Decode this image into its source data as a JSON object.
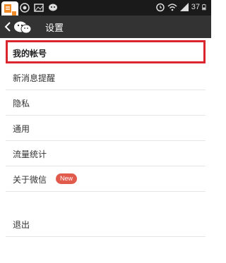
{
  "status_bar": {
    "battery_level": "37",
    "icons": [
      "notification-icon",
      "message-icon",
      "image-icon",
      "chat-icon",
      "alarm-icon",
      "wifi-icon",
      "signal-icon",
      "battery-icon"
    ]
  },
  "title_bar": {
    "title": "设置"
  },
  "menu": {
    "items": [
      {
        "label": "我的帐号"
      },
      {
        "label": "新消息提醒"
      },
      {
        "label": "隐私"
      },
      {
        "label": "通用"
      },
      {
        "label": "流量统计"
      },
      {
        "label": "关于微信",
        "badge": "New"
      },
      {
        "label": "退出"
      }
    ]
  },
  "colors": {
    "highlight": "#d9262e",
    "badge": "#e15b4d",
    "title_bar": "#333333"
  }
}
